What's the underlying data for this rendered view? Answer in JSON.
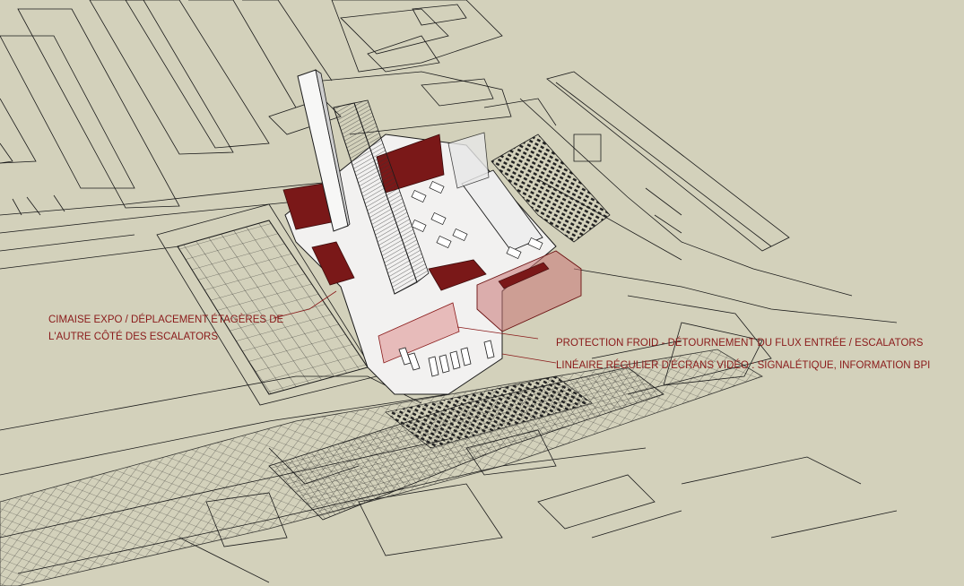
{
  "colors": {
    "background": "#d3d1bb",
    "line": "#1a1a1a",
    "highlight_red": "#7a1818",
    "annotation_red": "#8a1a1a",
    "floor_white": "#f2f1f0",
    "pink_transparent": "#e3a8a8"
  },
  "annotations": [
    {
      "id": "cimaise",
      "lines": [
        "CIMAISE EXPO / DÉPLACEMENT ÉTAGÈRES DE",
        "L'AUTRE CÔTÉ DES ESCALATORS"
      ]
    },
    {
      "id": "protection",
      "lines": [
        "PROTECTION FROID - DÉTOURNEMENT DU FLUX ENTRÉE / ESCALATORS"
      ]
    },
    {
      "id": "ecrans",
      "lines": [
        "LINÉAIRE RÉGULIER D'ÉCRANS VIDÉO : SIGNALÉTIQUE, INFORMATION BPI"
      ]
    }
  ]
}
